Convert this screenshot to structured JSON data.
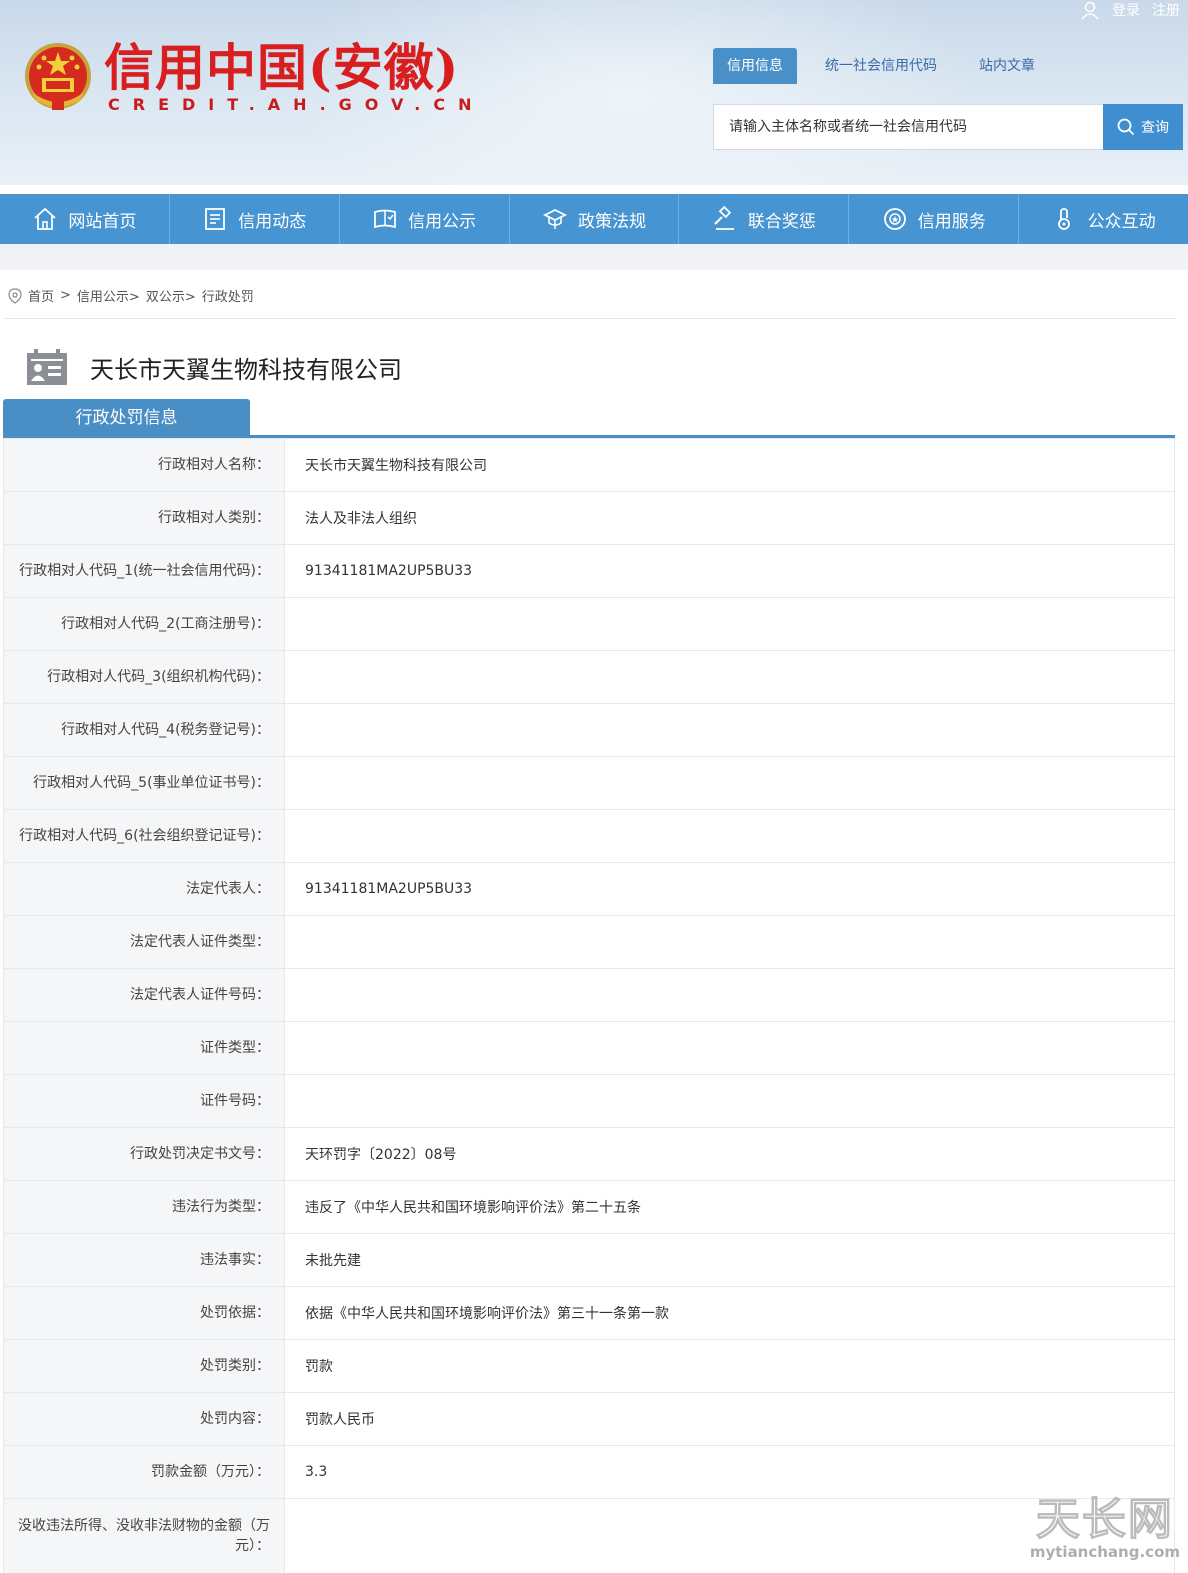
{
  "header": {
    "logo_cn": "信用中国(安徽)",
    "logo_en": "CREDIT.AH.GOV.CN",
    "login": "登录",
    "register": "注册",
    "search_tabs": [
      {
        "label": "信用信息"
      },
      {
        "label": "统一社会信用代码"
      },
      {
        "label": "站内文章"
      }
    ],
    "search_placeholder": "请输入主体名称或者统一社会信用代码",
    "search_button": "查询"
  },
  "nav": [
    {
      "label": "网站首页",
      "icon": "home-icon"
    },
    {
      "label": "信用动态",
      "icon": "news-icon"
    },
    {
      "label": "信用公示",
      "icon": "notice-icon"
    },
    {
      "label": "政策法规",
      "icon": "policy-icon"
    },
    {
      "label": "联合奖惩",
      "icon": "gavel-icon"
    },
    {
      "label": "信用服务",
      "icon": "service-icon"
    },
    {
      "label": "公众互动",
      "icon": "interact-icon"
    }
  ],
  "breadcrumb": {
    "home": "首页",
    "sep1": ">",
    "level1": "信用公示>",
    "level2": "双公示>",
    "level3": "行政处罚"
  },
  "company_name": "天长市天翼生物科技有限公司",
  "section_title": "行政处罚信息",
  "rows": [
    {
      "label": "行政相对人名称：",
      "value": "天长市天翼生物科技有限公司"
    },
    {
      "label": "行政相对人类别：",
      "value": "法人及非法人组织"
    },
    {
      "label": "行政相对人代码_1(统一社会信用代码)：",
      "value": "91341181MA2UP5BU33"
    },
    {
      "label": "行政相对人代码_2(工商注册号)：",
      "value": ""
    },
    {
      "label": "行政相对人代码_3(组织机构代码)：",
      "value": ""
    },
    {
      "label": "行政相对人代码_4(税务登记号)：",
      "value": ""
    },
    {
      "label": "行政相对人代码_5(事业单位证书号)：",
      "value": ""
    },
    {
      "label": "行政相对人代码_6(社会组织登记证号)：",
      "value": ""
    },
    {
      "label": "法定代表人：",
      "value": "91341181MA2UP5BU33"
    },
    {
      "label": "法定代表人证件类型：",
      "value": ""
    },
    {
      "label": "法定代表人证件号码：",
      "value": ""
    },
    {
      "label": "证件类型：",
      "value": ""
    },
    {
      "label": "证件号码：",
      "value": ""
    },
    {
      "label": "行政处罚决定书文号：",
      "value": "天环罚字〔2022〕08号"
    },
    {
      "label": "违法行为类型：",
      "value": "违反了《中华人民共和国环境影响评价法》第二十五条"
    },
    {
      "label": "违法事实：",
      "value": "未批先建"
    },
    {
      "label": "处罚依据：",
      "value": "依据《中华人民共和国环境影响评价法》第三十一条第一款"
    },
    {
      "label": "处罚类别：",
      "value": "罚款"
    },
    {
      "label": "处罚内容：",
      "value": "罚款人民币"
    },
    {
      "label": "罚款金额（万元）：",
      "value": "3.3"
    },
    {
      "label": "没收违法所得、没收非法财物的金额（万元）：",
      "value": ""
    }
  ],
  "watermark": {
    "big": "天长网",
    "small": "mytianchang.com"
  },
  "colors": {
    "accent": "#4694d2",
    "logo_red": "#d81e1e",
    "section_blue": "#4a8ec6"
  }
}
